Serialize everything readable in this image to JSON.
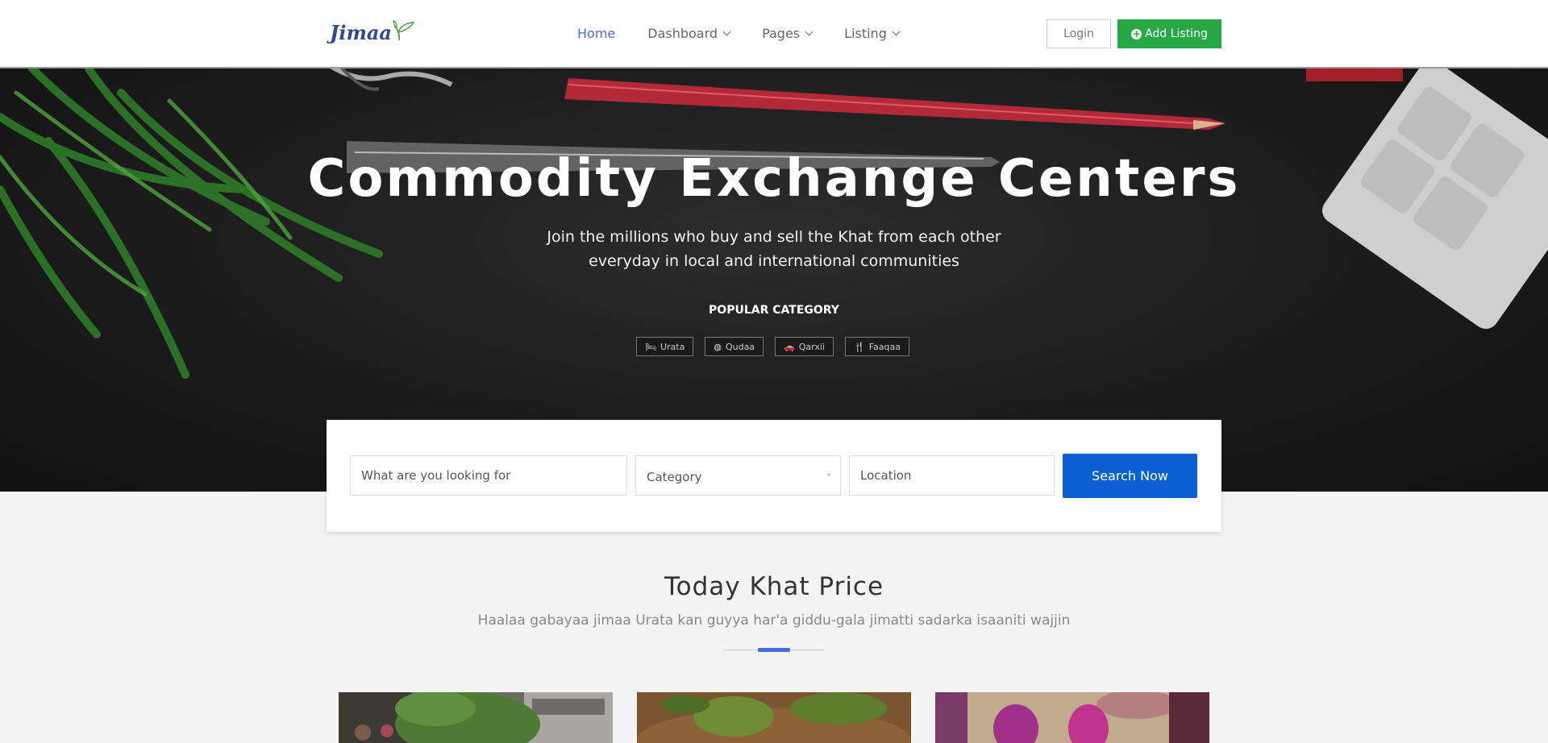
{
  "brand": {
    "name": "Jimaa",
    "leaf_color": "#3a9d3a"
  },
  "nav": {
    "items": [
      {
        "label": "Home",
        "active": true,
        "dropdown": false
      },
      {
        "label": "Dashboard",
        "active": false,
        "dropdown": true
      },
      {
        "label": "Pages",
        "active": false,
        "dropdown": true
      },
      {
        "label": "Listing",
        "active": false,
        "dropdown": true
      }
    ],
    "login_label": "Login",
    "add_listing_label": "Add Listing"
  },
  "hero": {
    "title": "Commodity Exchange Centers",
    "subtitle": "Join the millions who buy and sell the Khat from each other everyday in local and international communities",
    "popular_label": "POPULAR CATEGORY",
    "tags": [
      {
        "label": "Urata",
        "icon": "bed-icon"
      },
      {
        "label": "Qudaa",
        "icon": "compass-icon"
      },
      {
        "label": "Qarxii",
        "icon": "car-icon"
      },
      {
        "label": "Faaqaa",
        "icon": "cutlery-icon"
      }
    ]
  },
  "search": {
    "what_placeholder": "What are you looking for",
    "category_placeholder": "Category",
    "location_placeholder": "Location",
    "button_label": "Search Now"
  },
  "section": {
    "title": "Today Khat Price",
    "subtitle": "Haalaa gabayaa jimaa Urata kan guyya har'a giddu-gala jimatti sadarka isaaniti wajjin"
  },
  "colors": {
    "accent": "#4a6cd4",
    "add_button": "#28a745",
    "search_button": "#0b5fd1"
  }
}
